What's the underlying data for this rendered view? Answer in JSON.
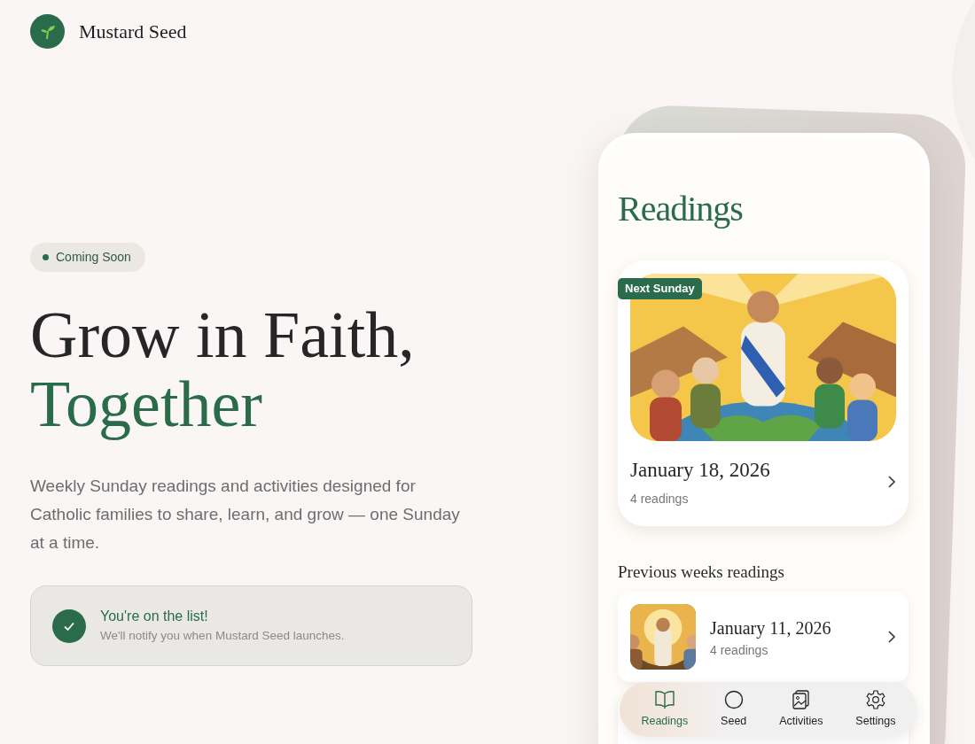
{
  "brand": {
    "name": "Mustard Seed"
  },
  "hero": {
    "badge": "Coming Soon",
    "headline": [
      {
        "text": "Grow in Faith,",
        "accent": false
      },
      {
        "text": "Together",
        "accent": true
      }
    ],
    "description": "Weekly Sunday readings and activities designed for Catholic families to share, learn, and grow — one Sunday at a time."
  },
  "notice": {
    "title": "You're on the list!",
    "message": "We'll notify you when Mustard Seed launches."
  },
  "phone": {
    "title": "Readings",
    "featured": {
      "badge": "Next Sunday",
      "date": "January 18, 2026",
      "count": "4 readings"
    },
    "section_title": "Previous weeks readings",
    "previous": [
      {
        "date": "January 11, 2026",
        "count": "4 readings"
      }
    ],
    "tabs": [
      {
        "label": "Readings",
        "kind": "book",
        "selected": true
      },
      {
        "label": "Seed",
        "kind": "circle",
        "selected": false
      },
      {
        "label": "Activities",
        "kind": "images",
        "selected": false
      },
      {
        "label": "Settings",
        "kind": "gear",
        "selected": false
      }
    ]
  }
}
